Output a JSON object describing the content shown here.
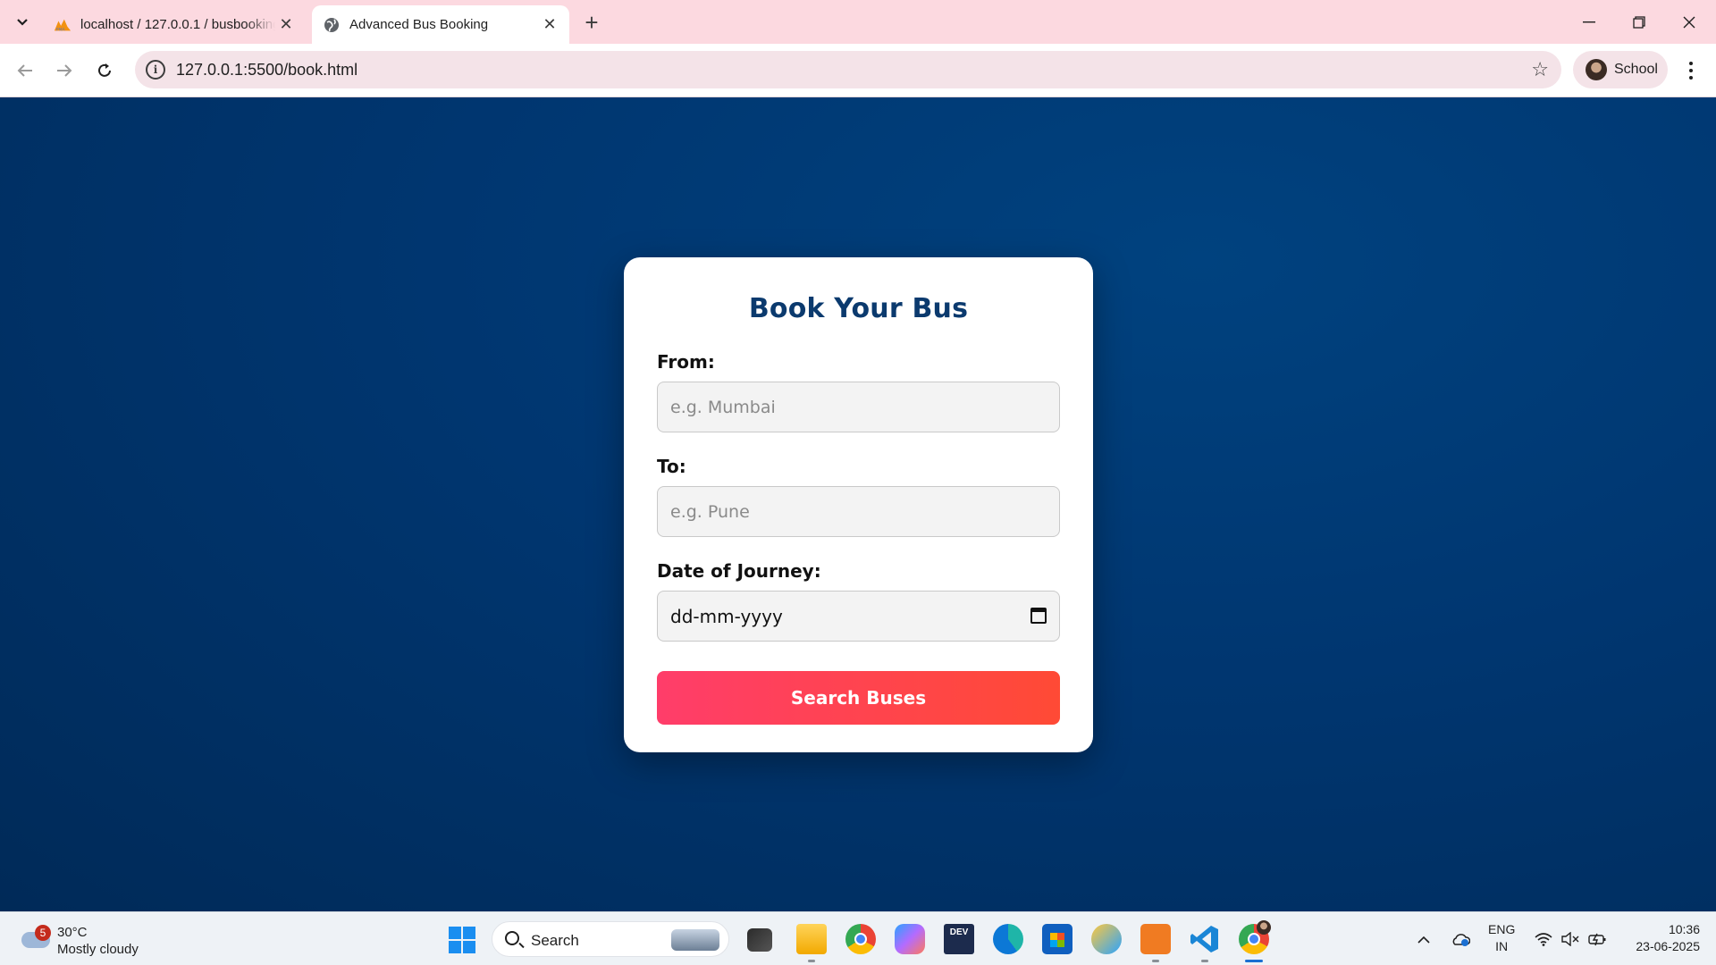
{
  "browser": {
    "tabs": [
      {
        "title": "localhost / 127.0.0.1 / busbooking",
        "active": false
      },
      {
        "title": "Advanced Bus Booking",
        "active": true
      }
    ],
    "url": "127.0.0.1:5500/book.html",
    "profile_name": "School"
  },
  "page": {
    "heading": "Book Your Bus",
    "from_label": "From:",
    "from_placeholder": "e.g. Mumbai",
    "to_label": "To:",
    "to_placeholder": "e.g. Pune",
    "date_label": "Date of Journey:",
    "date_placeholder": "dd-mm-yyyy",
    "search_button": "Search Buses",
    "colors": {
      "background": "#003670",
      "heading": "#0b3a6e",
      "button_start": "#ff3d6a",
      "button_end": "#ff4a35"
    }
  },
  "taskbar": {
    "weather_badge": "5",
    "temperature": "30°C",
    "weather": "Mostly cloudy",
    "search_label": "Search",
    "lang_top": "ENG",
    "lang_bottom": "IN",
    "time": "10:36",
    "date": "23-06-2025",
    "icons": [
      "task-view-icon",
      "file-explorer-icon",
      "chrome-icon",
      "copilot-icon",
      "devhome-icon",
      "edge-icon",
      "store-icon",
      "weather-app-icon",
      "xampp-icon",
      "vscode-icon",
      "chrome-profile-icon"
    ]
  }
}
